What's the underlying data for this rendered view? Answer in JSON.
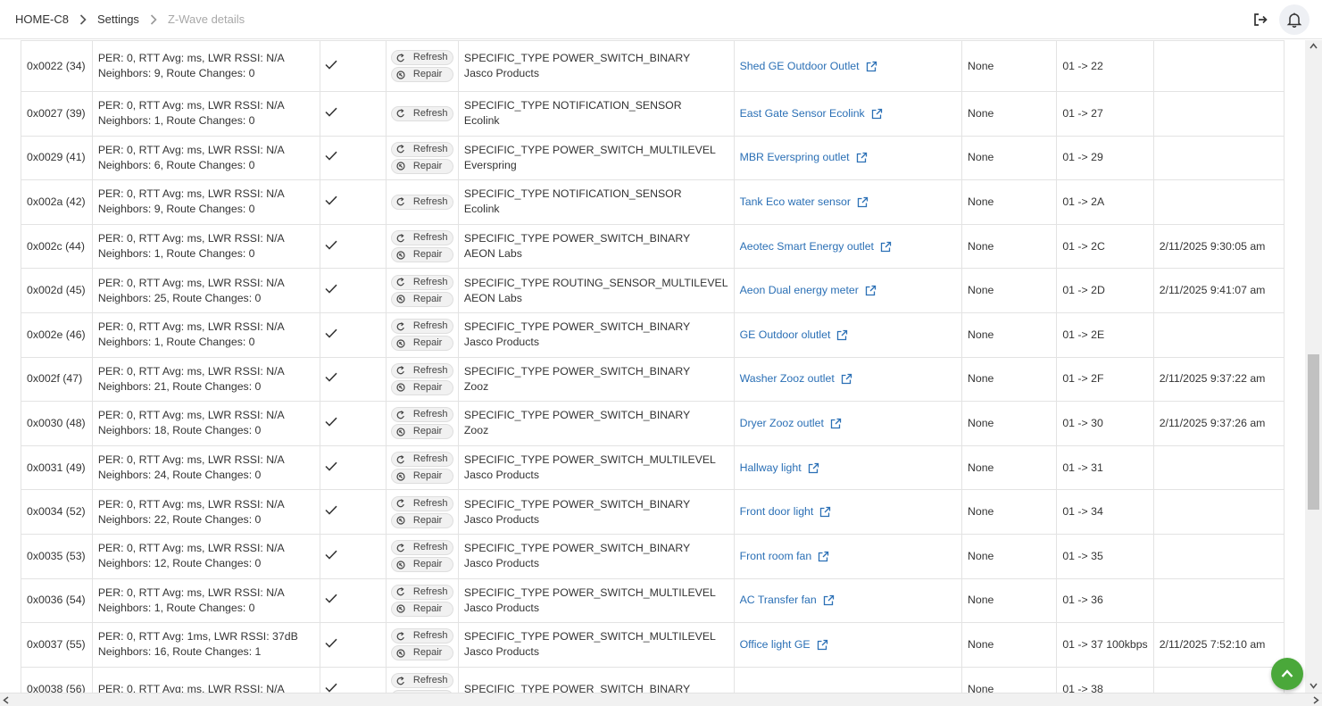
{
  "breadcrumb": {
    "home": "HOME-C8",
    "settings": "Settings",
    "current": "Z-Wave details"
  },
  "buttons": {
    "refresh": "Refresh",
    "repair": "Repair"
  },
  "rows": [
    {
      "id": "0x0022 (34)",
      "stats1": "PER: 0, RTT Avg: ms, LWR RSSI: N/A",
      "stats2": "Neighbors: 9, Route Changes: 0",
      "repair": true,
      "type": "SPECIFIC_TYPE POWER_SWITCH_BINARY",
      "mfr": "Jasco Products",
      "device": "Shed GE Outdoor Outlet",
      "security": "None",
      "route": "01 -> 22",
      "time": ""
    },
    {
      "id": "0x0027 (39)",
      "stats1": "PER: 0, RTT Avg: ms, LWR RSSI: N/A",
      "stats2": "Neighbors: 1, Route Changes: 0",
      "repair": false,
      "type": "SPECIFIC_TYPE NOTIFICATION_SENSOR",
      "mfr": "Ecolink",
      "device": "East Gate Sensor Ecolink",
      "security": "None",
      "route": "01 -> 27",
      "time": ""
    },
    {
      "id": "0x0029 (41)",
      "stats1": "PER: 0, RTT Avg: ms, LWR RSSI: N/A",
      "stats2": "Neighbors: 6, Route Changes: 0",
      "repair": true,
      "type": "SPECIFIC_TYPE POWER_SWITCH_MULTILEVEL",
      "mfr": "Everspring",
      "device": "MBR Everspring outlet",
      "security": "None",
      "route": "01 -> 29",
      "time": ""
    },
    {
      "id": "0x002a (42)",
      "stats1": "PER: 0, RTT Avg: ms, LWR RSSI: N/A",
      "stats2": "Neighbors: 9, Route Changes: 0",
      "repair": false,
      "type": "SPECIFIC_TYPE NOTIFICATION_SENSOR",
      "mfr": "Ecolink",
      "device": "Tank Eco water sensor",
      "security": "None",
      "route": "01 -> 2A",
      "time": ""
    },
    {
      "id": "0x002c (44)",
      "stats1": "PER: 0, RTT Avg: ms, LWR RSSI: N/A",
      "stats2": "Neighbors: 1, Route Changes: 0",
      "repair": true,
      "type": "SPECIFIC_TYPE POWER_SWITCH_BINARY",
      "mfr": "AEON Labs",
      "device": "Aeotec Smart Energy outlet",
      "security": "None",
      "route": "01 -> 2C",
      "time": "2/11/2025 9:30:05 am"
    },
    {
      "id": "0x002d (45)",
      "stats1": "PER: 0, RTT Avg: ms, LWR RSSI: N/A",
      "stats2": "Neighbors: 25, Route Changes: 0",
      "repair": true,
      "type": "SPECIFIC_TYPE ROUTING_SENSOR_MULTILEVEL",
      "mfr": "AEON Labs",
      "device": "Aeon Dual energy meter",
      "security": "None",
      "route": "01 -> 2D",
      "time": "2/11/2025 9:41:07 am"
    },
    {
      "id": "0x002e (46)",
      "stats1": "PER: 0, RTT Avg: ms, LWR RSSI: N/A",
      "stats2": "Neighbors: 1, Route Changes: 0",
      "repair": true,
      "type": "SPECIFIC_TYPE POWER_SWITCH_BINARY",
      "mfr": "Jasco Products",
      "device": "GE Outdoor olutlet",
      "security": "None",
      "route": "01 -> 2E",
      "time": ""
    },
    {
      "id": "0x002f (47)",
      "stats1": "PER: 0, RTT Avg: ms, LWR RSSI: N/A",
      "stats2": "Neighbors: 21, Route Changes: 0",
      "repair": true,
      "type": "SPECIFIC_TYPE POWER_SWITCH_BINARY",
      "mfr": "Zooz",
      "device": "Washer Zooz outlet",
      "security": "None",
      "route": "01 -> 2F",
      "time": "2/11/2025 9:37:22 am"
    },
    {
      "id": "0x0030 (48)",
      "stats1": "PER: 0, RTT Avg: ms, LWR RSSI: N/A",
      "stats2": "Neighbors: 18, Route Changes: 0",
      "repair": true,
      "type": "SPECIFIC_TYPE POWER_SWITCH_BINARY",
      "mfr": "Zooz",
      "device": "Dryer Zooz outlet",
      "security": "None",
      "route": "01 -> 30",
      "time": "2/11/2025 9:37:26 am"
    },
    {
      "id": "0x0031 (49)",
      "stats1": "PER: 0, RTT Avg: ms, LWR RSSI: N/A",
      "stats2": "Neighbors: 24, Route Changes: 0",
      "repair": true,
      "type": "SPECIFIC_TYPE POWER_SWITCH_MULTILEVEL",
      "mfr": "Jasco Products",
      "device": "Hallway light",
      "security": "None",
      "route": "01 -> 31",
      "time": ""
    },
    {
      "id": "0x0034 (52)",
      "stats1": "PER: 0, RTT Avg: ms, LWR RSSI: N/A",
      "stats2": "Neighbors: 22, Route Changes: 0",
      "repair": true,
      "type": "SPECIFIC_TYPE POWER_SWITCH_BINARY",
      "mfr": "Jasco Products",
      "device": "Front door light",
      "security": "None",
      "route": "01 -> 34",
      "time": ""
    },
    {
      "id": "0x0035 (53)",
      "stats1": "PER: 0, RTT Avg: ms, LWR RSSI: N/A",
      "stats2": "Neighbors: 12, Route Changes: 0",
      "repair": true,
      "type": "SPECIFIC_TYPE POWER_SWITCH_BINARY",
      "mfr": "Jasco Products",
      "device": "Front room fan",
      "security": "None",
      "route": "01 -> 35",
      "time": ""
    },
    {
      "id": "0x0036 (54)",
      "stats1": "PER: 0, RTT Avg: ms, LWR RSSI: N/A",
      "stats2": "Neighbors: 1, Route Changes: 0",
      "repair": true,
      "type": "SPECIFIC_TYPE POWER_SWITCH_MULTILEVEL",
      "mfr": "Jasco Products",
      "device": "AC Transfer fan",
      "security": "None",
      "route": "01 -> 36",
      "time": ""
    },
    {
      "id": "0x0037 (55)",
      "stats1": "PER: 0, RTT Avg: 1ms, LWR RSSI: 37dB",
      "stats2": "Neighbors: 16, Route Changes: 1",
      "repair": true,
      "type": "SPECIFIC_TYPE POWER_SWITCH_MULTILEVEL",
      "mfr": "Jasco Products",
      "device": "Office light GE",
      "security": "None",
      "route": "01 -> 37 100kbps",
      "time": "2/11/2025 7:52:10 am"
    },
    {
      "id": "0x0038 (56)",
      "stats1": "PER: 0, RTT Avg: ms, LWR RSSI: N/A",
      "stats2": "",
      "repair": true,
      "type": "SPECIFIC_TYPE POWER_SWITCH_BINARY",
      "mfr": "",
      "device": "",
      "security": "None",
      "route": "01 -> 38",
      "time": ""
    }
  ]
}
